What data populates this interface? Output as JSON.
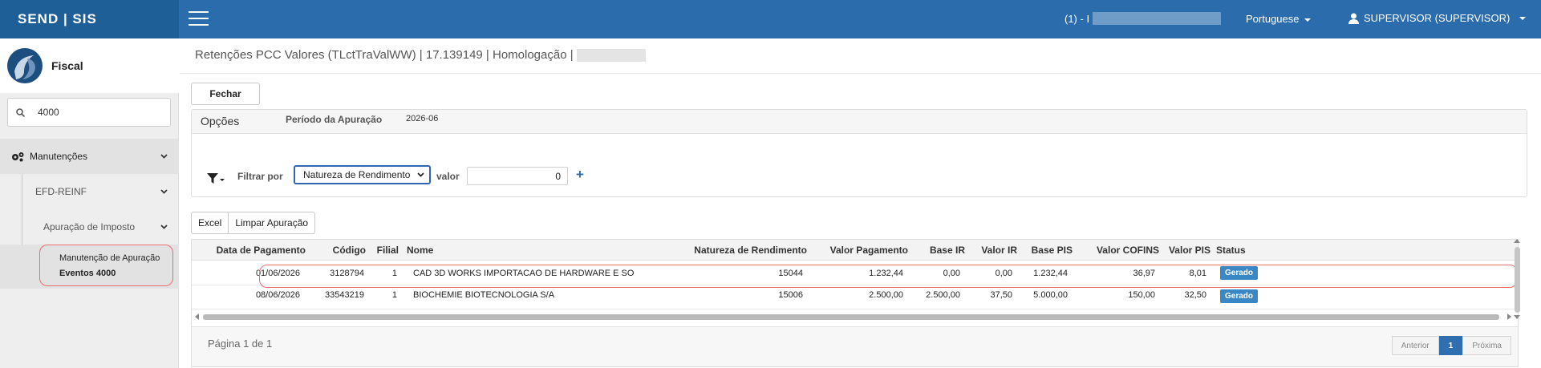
{
  "app": {
    "brand": "SEND | SIS",
    "company": "(1) - I",
    "language": "Portuguese",
    "user": "SUPERVISOR (SUPERVISOR)"
  },
  "sidebar": {
    "module": "Fiscal",
    "search_value": "4000",
    "items": [
      {
        "label": "Manutenções"
      },
      {
        "label": "EFD-REINF"
      },
      {
        "label": "Apuração de Imposto"
      },
      {
        "label": "Manutenção de Apuração",
        "label2": "Eventos 4000"
      }
    ]
  },
  "page": {
    "title": "Retenções PCC Valores (TLctTraValWW) | 17.139149 | Homologação |",
    "close_label": "Fechar",
    "options_title": "Opções",
    "periodo_label": "Período da Apuração",
    "periodo_value": "2026-06",
    "filter_label": "Filtrar por",
    "filter_selected": "Natureza de Rendimento",
    "valor_label": "valor",
    "valor_value": "0",
    "plus": "+",
    "excel_label": "Excel",
    "limpar_label": "Limpar Apuração"
  },
  "grid": {
    "columns": [
      "Data de Pagamento",
      "Código",
      "Filial",
      "Nome",
      "Natureza de Rendimento",
      "Valor Pagamento",
      "Base IR",
      "Valor IR",
      "Base PIS",
      "Valor COFINS",
      "Valor PIS",
      "Status"
    ],
    "rows": [
      {
        "data": "01/06/2026",
        "codigo": "3128794",
        "filial": "1",
        "nome": "CAD 3D WORKS IMPORTACAO DE HARDWARE E SO",
        "natureza": "15044",
        "valor_pagamento": "1.232,44",
        "base_ir": "0,00",
        "valor_ir": "0,00",
        "base_pis": "1.232,44",
        "valor_cofins": "36,97",
        "valor_pis": "8,01",
        "status": "Gerado"
      },
      {
        "data": "08/06/2026",
        "codigo": "33543219",
        "filial": "1",
        "nome": "BIOCHEMIE BIOTECNOLOGIA S/A",
        "natureza": "15006",
        "valor_pagamento": "2.500,00",
        "base_ir": "2.500,00",
        "valor_ir": "37,50",
        "base_pis": "5.000,00",
        "valor_cofins": "150,00",
        "valor_pis": "32,50",
        "status": "Gerado"
      }
    ],
    "page_info": "Página 1 de 1",
    "pager": {
      "prev": "Anterior",
      "current": "1",
      "next": "Próxima"
    }
  },
  "colors": {
    "header": "#2b6cad",
    "brand_bg": "#1f5f97",
    "highlight": "#e86f6f",
    "badge": "#3a87c6"
  }
}
